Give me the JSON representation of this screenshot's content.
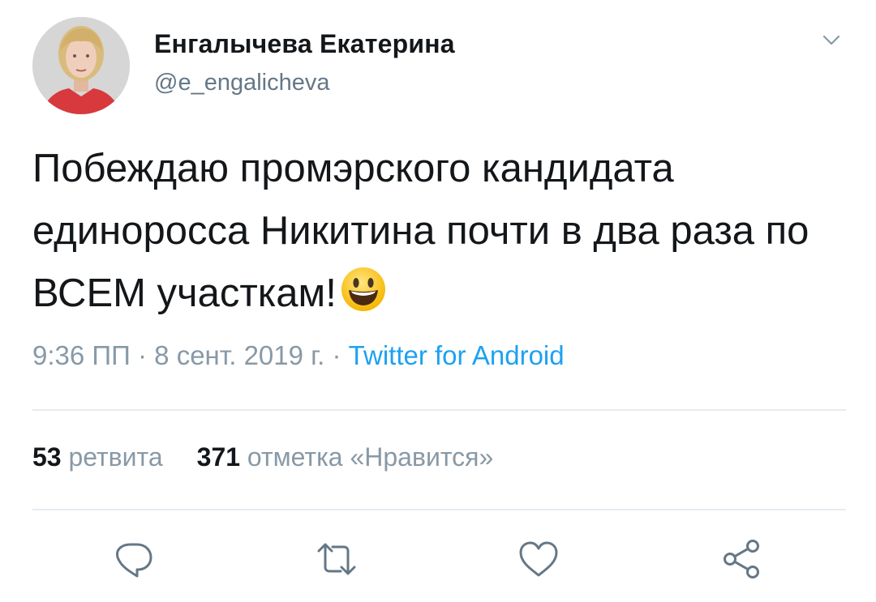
{
  "author": {
    "display_name": "Енгалычева Екатерина",
    "handle": "@e_engalicheva"
  },
  "tweet": {
    "text": "Побеждаю промэрского кандидата единоросса Никитина почти в два раза по ВСЕМ участкам!",
    "emoji_icon": "grinning-face-emoji"
  },
  "meta": {
    "time": "9:36 ПП",
    "separator1": " · ",
    "date": "8 сент. 2019 г.",
    "separator2": " · ",
    "source": "Twitter for Android"
  },
  "stats": {
    "retweets_count": "53",
    "retweets_label": "ретвита",
    "likes_count": "371",
    "likes_label": "отметка «Нравится»"
  },
  "actions": [
    "reply-icon",
    "retweet-icon",
    "like-icon",
    "share-icon"
  ],
  "colors": {
    "text": "#14171a",
    "secondary": "#657786",
    "muted": "#8899a6",
    "link": "#1da1f2",
    "divider": "#e6ecf0",
    "icon": "#657786"
  }
}
